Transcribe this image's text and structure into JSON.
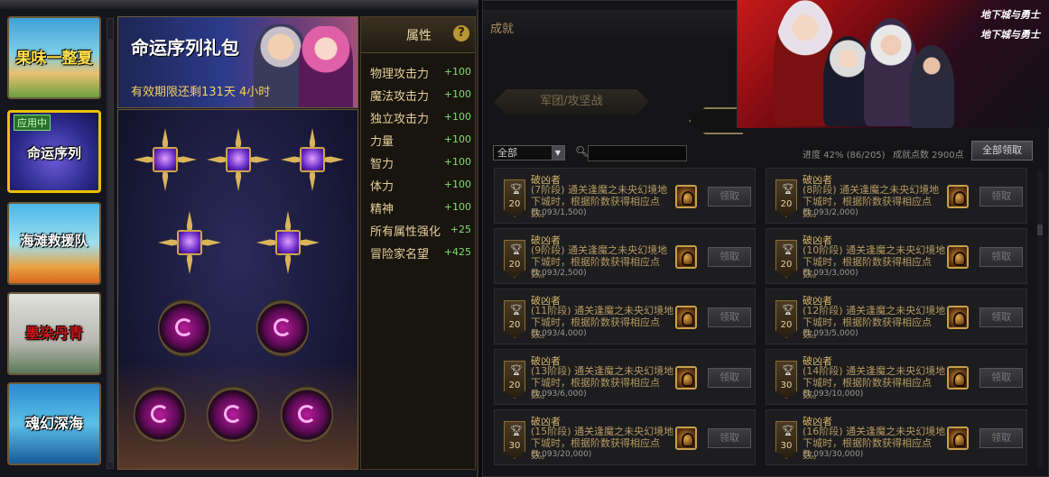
{
  "left_window": {
    "title": "",
    "packages": [
      {
        "label": "果味一整夏",
        "active": false,
        "badge": ""
      },
      {
        "label": "命运序列",
        "active": true,
        "badge": "应用中"
      },
      {
        "label": "海滩救援队",
        "active": false,
        "badge": ""
      },
      {
        "label": "墨染丹青",
        "active": false,
        "badge": ""
      },
      {
        "label": "魂幻深海",
        "active": false,
        "badge": ""
      }
    ],
    "banner": {
      "title": "命运序列礼包",
      "expire": "有效期限还剩131天 4小时"
    },
    "attributes": {
      "title": "属性",
      "help": "?",
      "rows": [
        {
          "name": "物理攻击力",
          "value": "+100"
        },
        {
          "name": "魔法攻击力",
          "value": "+100"
        },
        {
          "name": "独立攻击力",
          "value": "+100"
        },
        {
          "name": "力量",
          "value": "+100"
        },
        {
          "name": "智力",
          "value": "+100"
        },
        {
          "name": "体力",
          "value": "+100"
        },
        {
          "name": "精神",
          "value": "+100"
        },
        {
          "name": "所有属性强化",
          "value": "+25"
        },
        {
          "name": "冒险家名望",
          "value": "+425"
        }
      ]
    }
  },
  "right_window": {
    "title": "成就",
    "tab_juntuan": "军团/攻坚战",
    "filter_value": "全部",
    "progress": "进度  42% (86/205)",
    "points": "成就点数 2900点",
    "claim_all": "全部领取",
    "achievements": [
      {
        "badge": "20",
        "name": "破凶者",
        "desc": "(7阶段) 通关逢魔之未央幻境地下城时，根据阶数获得相应点数。",
        "progress": "(1,093/1,500)",
        "claim": "领取"
      },
      {
        "badge": "20",
        "name": "破凶者",
        "desc": "(8阶段) 通关逢魔之未央幻境地下城时，根据阶数获得相应点数。",
        "progress": "(1,093/2,000)",
        "claim": "领取"
      },
      {
        "badge": "20",
        "name": "破凶者",
        "desc": "(9阶段) 通关逢魔之未央幻境地下城时，根据阶数获得相应点数。",
        "progress": "(1,093/2,500)",
        "claim": "领取"
      },
      {
        "badge": "20",
        "name": "破凶者",
        "desc": "(10阶段) 通关逢魔之未央幻境地下城时，根据阶数获得相应点数。",
        "progress": "(1,093/3,000)",
        "claim": "领取"
      },
      {
        "badge": "20",
        "name": "破凶者",
        "desc": "(11阶段) 通关逢魔之未央幻境地下城时，根据阶数获得相应点数。",
        "progress": "(1,093/4,000)",
        "claim": "领取"
      },
      {
        "badge": "20",
        "name": "破凶者",
        "desc": "(12阶段) 通关逢魔之未央幻境地下城时，根据阶数获得相应点数。",
        "progress": "(1,093/5,000)",
        "claim": "领取"
      },
      {
        "badge": "20",
        "name": "破凶者",
        "desc": "(13阶段) 通关逢魔之未央幻境地下城时，根据阶数获得相应点数。",
        "progress": "(1,093/6,000)",
        "claim": "领取"
      },
      {
        "badge": "30",
        "name": "破凶者",
        "desc": "(14阶段) 通关逢魔之未央幻境地下城时，根据阶数获得相应点数。",
        "progress": "(1,093/10,000)",
        "claim": "领取"
      },
      {
        "badge": "30",
        "name": "破凶者",
        "desc": "(15阶段) 通关逢魔之未央幻境地下城时，根据阶数获得相应点数。",
        "progress": "(1,093/20,000)",
        "claim": "领取"
      },
      {
        "badge": "30",
        "name": "破凶者",
        "desc": "(16阶段) 通关逢魔之未央幻境地下城时，根据阶数获得相应点数。",
        "progress": "(1,093/30,000)",
        "claim": "领取"
      }
    ]
  },
  "promo": {
    "logo_1": "地下城与勇士",
    "logo_2": "地下城与勇士"
  },
  "colors": {
    "gold_text": "#e6cf9a",
    "green_value": "#7fe06a",
    "active_border": "#f0c000"
  }
}
